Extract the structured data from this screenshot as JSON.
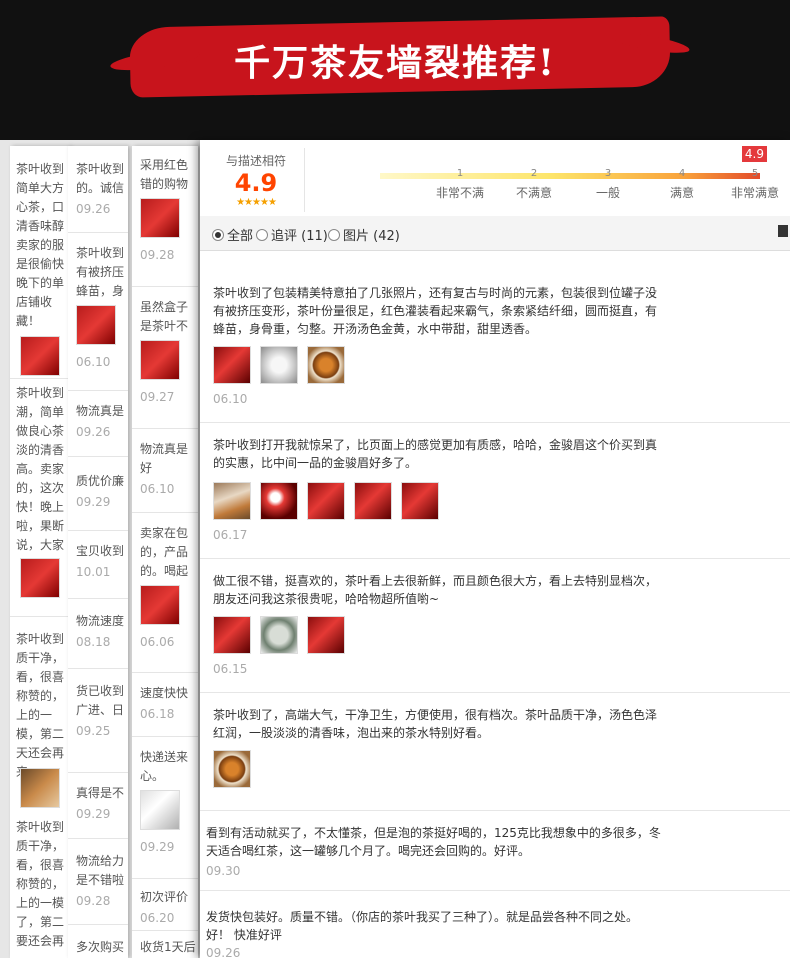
{
  "banner": {
    "title": "千万茶友墙裂推荐!"
  },
  "background_columns": [
    {
      "entries": [
        {
          "text": "茶叶收到简单大方心茶，口清香味醇卖家的服是很偷快晚下的单店铺收藏！",
          "date": ""
        },
        {
          "text": "茶叶收到潮，简单做良心茶淡的清香高。卖家的，这次快！晚上啦，果断说，大家",
          "date": ""
        },
        {
          "text": "茶叶收到质干净，看，很喜称赞的，上的一模，第二天还会再来",
          "date": ""
        },
        {
          "text": "茶叶收到质干净，看，很喜称赞的，上的一模了，第二要还会再",
          "date": ""
        }
      ]
    },
    {
      "entries": [
        {
          "text": "茶叶收到的。诚信",
          "date": "09.26"
        },
        {
          "text": "茶叶收到有被挤压蜂苗，身",
          "date": "06.10"
        },
        {
          "text": "物流真是",
          "date": "09.26"
        },
        {
          "text": "质优价廉",
          "date": "09.29"
        },
        {
          "text": "宝贝收到",
          "date": "10.01"
        },
        {
          "text": "物流速度",
          "date": "08.18"
        },
        {
          "text": "货已收到广进、日",
          "date": "09.25"
        },
        {
          "text": "真得是不",
          "date": "09.29"
        },
        {
          "text": "物流给力是不错啦",
          "date": "09.28"
        },
        {
          "text": "多次购买",
          "date": ""
        }
      ]
    },
    {
      "entries": [
        {
          "text": "采用红色错的购物",
          "date": "09.28"
        },
        {
          "text": "虽然盒子是茶叶不",
          "date": "09.27"
        },
        {
          "text": "物流真是好",
          "date": "06.10"
        },
        {
          "text": "卖家在包的，产品的。喝起",
          "date": "06.06"
        },
        {
          "text": "速度快快",
          "date": "06.18"
        },
        {
          "text": "快递送来心。",
          "date": "09.29"
        },
        {
          "text": "初次评价",
          "date": "06.20"
        },
        {
          "text": "收货1天后",
          "date": ""
        }
      ]
    }
  ],
  "rating": {
    "label": "与描述相符",
    "score": "4.9",
    "stars": "★★★★★",
    "badge": "4.9",
    "scale_numbers": [
      "1",
      "2",
      "3",
      "4",
      "5"
    ],
    "scale_labels": [
      "非常不满",
      "不满意",
      "一般",
      "满意",
      "非常满意"
    ],
    "score_fraction": 0.98
  },
  "filter": {
    "all": "全部",
    "followup": "追评 (11)",
    "pictures": "图片 (42)"
  },
  "reviews": [
    {
      "text": "茶叶收到了包装精美特意拍了几张照片，还有复古与时尚的元素，包装很到位罐子没有被挤压变形，茶叶份量很足，红色灌装看起来霸气，条索紧结纤细，圆而挺直，有蜂苗，身骨重，匀整。开汤汤色金黄，水中带甜，甜里透香。",
      "date": "06.10",
      "images": [
        "red-tin-photo",
        "tea-tin-white",
        "brewed-tea-cup"
      ]
    },
    {
      "text": "茶叶收到打开我就惊呆了，比页面上的感觉更加有质感，哈哈，金骏眉这个价买到真的实惠，比中间一品的金骏眉好多了。",
      "date": "06.17",
      "images": [
        "tea-set-photo",
        "red-tin-photo",
        "red-tin-photo",
        "red-tin-photo",
        "red-tin-photo"
      ]
    },
    {
      "text": "做工很不错，挺喜欢的，茶叶看上去很新鲜，而且颜色很大方，看上去特别显档次，朋友还问我这茶很贵呢，哈哈物超所值喲~",
      "date": "06.15",
      "images": [
        "red-tin-photo",
        "tea-bowl-photo",
        "red-tin-photo"
      ]
    },
    {
      "text": "茶叶收到了，高端大气，干净卫生，方便使用，很有档次。茶叶品质干净，汤色色泽红润，一股淡淡的清香味，泡出来的茶水特别好看。",
      "date": "",
      "images": [
        "brewed-tea-cup"
      ]
    },
    {
      "text": "看到有活动就买了，不太懂茶，但是泡的茶挺好喝的，125克比我想象中的多很多，冬天适合喝红茶，这一罐够几个月了。喝完还会回购的。好评。",
      "date": "09.30",
      "images": []
    },
    {
      "text": "发货快包装好。质量不错。（你店的茶叶我买了三种了）。就是品尝各种不同之处。好！ 快准好评",
      "date": "09.26",
      "images": []
    }
  ]
}
